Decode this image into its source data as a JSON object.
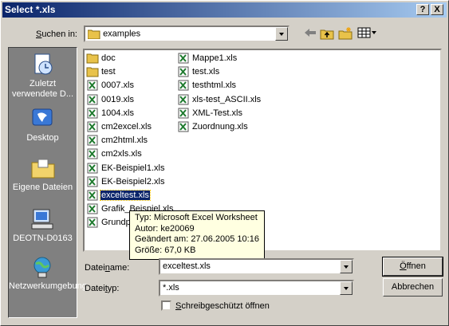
{
  "window": {
    "title": "Select *.xls"
  },
  "titlebar": {
    "help_label": "?",
    "close_label": "X"
  },
  "lookin": {
    "label_pre": "",
    "label_u": "S",
    "label_post": "uchen in:",
    "value": "examples"
  },
  "places": [
    {
      "label": "Zuletzt verwendete D...",
      "icon": "recent-documents-icon"
    },
    {
      "label": "Desktop",
      "icon": "desktop-icon"
    },
    {
      "label": "Eigene Dateien",
      "icon": "my-documents-icon"
    },
    {
      "label": "DEOTN-D0163",
      "icon": "my-computer-icon"
    },
    {
      "label": "Netzwerkumgebung",
      "icon": "network-icon"
    }
  ],
  "files_col1": [
    {
      "name": "doc",
      "type": "folder"
    },
    {
      "name": "test",
      "type": "folder"
    },
    {
      "name": "0007.xls",
      "type": "xls"
    },
    {
      "name": "0019.xls",
      "type": "xls"
    },
    {
      "name": "1004.xls",
      "type": "xls"
    },
    {
      "name": "cm2excel.xls",
      "type": "xls"
    },
    {
      "name": "cm2html.xls",
      "type": "xls"
    },
    {
      "name": "cm2xls.xls",
      "type": "xls"
    },
    {
      "name": "EK-Beispiel1.xls",
      "type": "xls"
    },
    {
      "name": "EK-Beispiel2.xls",
      "type": "xls"
    },
    {
      "name": "exceltest.xls",
      "type": "xls",
      "selected": true
    },
    {
      "name": "Grafik_Beispiel.xls",
      "type": "xls"
    },
    {
      "name": "Grundpl",
      "type": "xls"
    }
  ],
  "files_col2": [
    {
      "name": "Mappe1.xls",
      "type": "xls"
    },
    {
      "name": "test.xls",
      "type": "xls"
    },
    {
      "name": "testhtml.xls",
      "type": "xls"
    },
    {
      "name": "xls-test_ASCII.xls",
      "type": "xls"
    },
    {
      "name": "XML-Test.xls",
      "type": "xls"
    },
    {
      "name": "Zuordnung.xls",
      "type": "xls"
    }
  ],
  "tooltip": {
    "line1": "Typ: Microsoft Excel Worksheet",
    "line2": "Autor: ke20069",
    "line3": "Geändert am: 27.06.2005 10:16",
    "line4": "Größe: 67,0 KB"
  },
  "filename": {
    "label_pre": "Datei",
    "label_u": "n",
    "label_post": "ame:",
    "value": "exceltest.xls"
  },
  "filetype": {
    "label_pre": "Datei",
    "label_u": "t",
    "label_post": "yp:",
    "value": "*.xls"
  },
  "readonly": {
    "label_u": "S",
    "label_post": "chreibgeschützt öffnen"
  },
  "buttons": {
    "open_u": "Ö",
    "open_post": "ffnen",
    "cancel": "Abbrechen"
  }
}
